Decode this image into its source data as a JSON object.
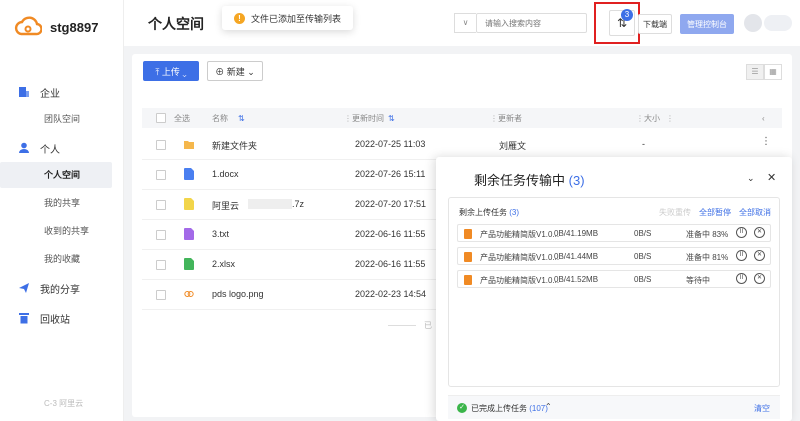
{
  "brand": {
    "name": "stg8897"
  },
  "sidebar": {
    "groups": [
      {
        "label": "企业",
        "icon": "building-icon",
        "items": [
          {
            "label": "团队空间",
            "active": false
          }
        ]
      },
      {
        "label": "个人",
        "icon": "user-icon",
        "items": [
          {
            "label": "个人空间",
            "active": true
          },
          {
            "label": "我的共享",
            "active": false
          },
          {
            "label": "收到的共享",
            "active": false
          },
          {
            "label": "我的收藏",
            "active": false
          }
        ]
      },
      {
        "label": "我的分享",
        "icon": "share-icon",
        "items": []
      },
      {
        "label": "回收站",
        "icon": "trash-icon",
        "items": []
      }
    ],
    "footer": "C-3 阿里云"
  },
  "header": {
    "title": "个人空间",
    "toast": "文件已添加至传输列表",
    "search_placeholder": "请输入搜索内容",
    "transfer_badge": "3",
    "download_label": "下载端",
    "console_label": "管理控制台"
  },
  "toolbar": {
    "upload_label": "上传",
    "new_label": "新建"
  },
  "table": {
    "headers": {
      "select_all": "全选",
      "name": "名称",
      "updated": "更新时间",
      "updater": "更新者",
      "size": "大小"
    },
    "rows": [
      {
        "name": "新建文件夹",
        "updated": "2022-07-25 11:03",
        "updater": "刘雁文",
        "size": "-",
        "icon": "folder-icon",
        "color": "#f5b74c"
      },
      {
        "name": "1.docx",
        "updated": "2022-07-26 15:11",
        "updater": "",
        "size": "",
        "icon": "doc-icon",
        "color": "#4a7ff0"
      },
      {
        "name": "阿里云",
        "name_suffix": ".7z",
        "updated": "2022-07-20 17:51",
        "updater": "",
        "size": "",
        "icon": "archive-icon",
        "color": "#f2d54a"
      },
      {
        "name": "3.txt",
        "updated": "2022-06-16 11:55",
        "updater": "",
        "size": "",
        "icon": "txt-icon",
        "color": "#a36ae8"
      },
      {
        "name": "2.xlsx",
        "updated": "2022-06-16 11:55",
        "updater": "",
        "size": "",
        "icon": "xlsx-icon",
        "color": "#43b55b"
      },
      {
        "name": "pds logo.png",
        "updated": "2022-02-23 14:54",
        "updater": "",
        "size": "",
        "icon": "image-icon",
        "color": "#f08a24"
      }
    ],
    "footer_text": "已"
  },
  "transfer_panel": {
    "title": "剩余任务传输中",
    "count": "(3)",
    "section_label": "剩余上传任务",
    "section_count": "(3)",
    "fail_retry": "失败重传",
    "pause_all": "全部暂停",
    "cancel_all": "全部取消",
    "tasks": [
      {
        "name": "产品功能精简版V1.0...",
        "progress": "0B/41.19MB",
        "speed": "0B/S",
        "status": "准备中 83%"
      },
      {
        "name": "产品功能精简版V1.0...",
        "progress": "0B/41.44MB",
        "speed": "0B/S",
        "status": "准备中 81%"
      },
      {
        "name": "产品功能精简版V1.0...",
        "progress": "0B/41.52MB",
        "speed": "0B/S",
        "status": "等待中"
      }
    ],
    "completed_label": "已完成上传任务",
    "completed_count": "(107)",
    "clear_label": "清空"
  },
  "colors": {
    "primary": "#3d6fe6",
    "highlight": "#e02020",
    "warning": "#f5a623",
    "success": "#3bb54a"
  }
}
